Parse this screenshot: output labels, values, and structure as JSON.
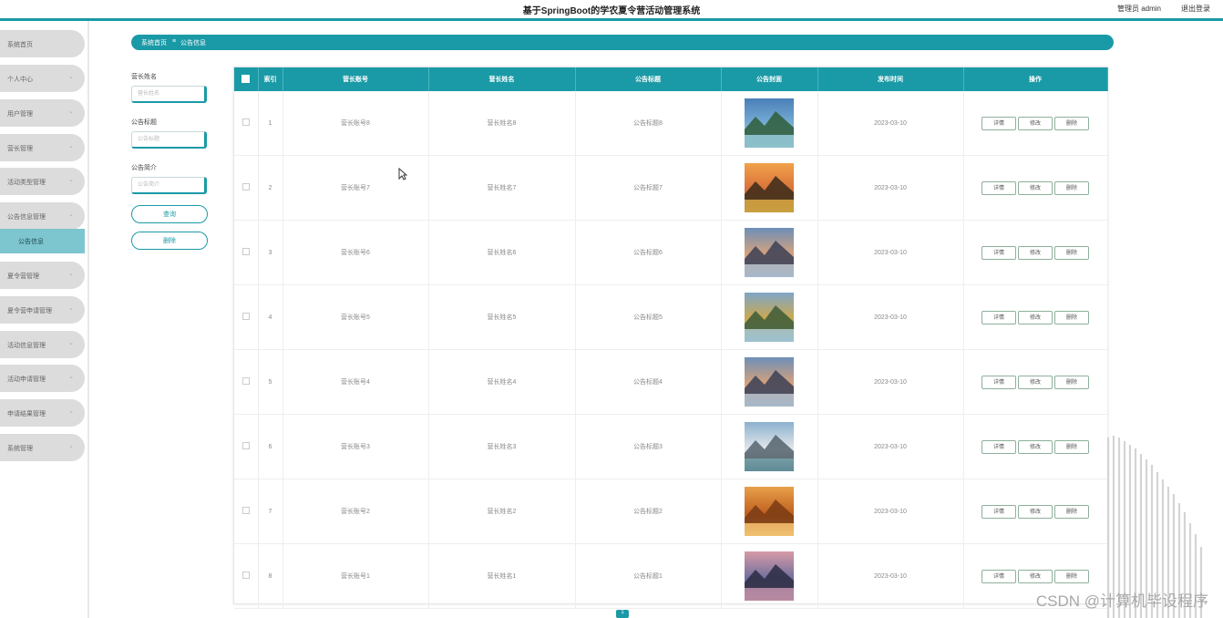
{
  "app": {
    "title": "基于SpringBoot的学农夏令营活动管理系统",
    "user": "管理员 admin",
    "logout": "退出登录"
  },
  "sidebar": {
    "items": [
      {
        "label": "系统首页",
        "arrow": false
      },
      {
        "label": "个人中心",
        "arrow": true
      },
      {
        "label": "用户管理",
        "arrow": true
      },
      {
        "label": "营长管理",
        "arrow": true
      },
      {
        "label": "活动类型管理",
        "arrow": true
      },
      {
        "label": "公告信息管理",
        "arrow": true
      },
      {
        "label": "夏令营管理",
        "arrow": true
      },
      {
        "label": "夏令营申请管理",
        "arrow": true
      },
      {
        "label": "活动信息管理",
        "arrow": true
      },
      {
        "label": "活动申请管理",
        "arrow": true
      },
      {
        "label": "申请结果管理",
        "arrow": true
      },
      {
        "label": "系统管理",
        "arrow": true
      }
    ],
    "submenu": "公告信息"
  },
  "breadcrumb": {
    "home": "系统首页",
    "sep": "≡",
    "current": "公告信息"
  },
  "search": {
    "fields": [
      {
        "label": "营长姓名",
        "placeholder": "营长姓名"
      },
      {
        "label": "公告标题",
        "placeholder": "公告标题"
      },
      {
        "label": "公告简介",
        "placeholder": "公告简介"
      }
    ],
    "query_button": "查询",
    "delete_button": "删除"
  },
  "table": {
    "headers": [
      "索引",
      "营长账号",
      "营长姓名",
      "公告标题",
      "公告封面",
      "发布时间",
      "操作"
    ],
    "rows": [
      {
        "index": "1",
        "account": "营长账号8",
        "name": "营长姓名8",
        "title": "公告标题8",
        "date": "2023-03-10"
      },
      {
        "index": "2",
        "account": "营长账号7",
        "name": "营长姓名7",
        "title": "公告标题7",
        "date": "2023-03-10"
      },
      {
        "index": "3",
        "account": "营长账号6",
        "name": "营长姓名6",
        "title": "公告标题6",
        "date": "2023-03-10"
      },
      {
        "index": "4",
        "account": "营长账号5",
        "name": "营长姓名5",
        "title": "公告标题5",
        "date": "2023-03-10"
      },
      {
        "index": "5",
        "account": "营长账号4",
        "name": "营长姓名4",
        "title": "公告标题4",
        "date": "2023-03-10"
      },
      {
        "index": "6",
        "account": "营长账号3",
        "name": "营长姓名3",
        "title": "公告标题3",
        "date": "2023-03-10"
      },
      {
        "index": "7",
        "account": "营长账号2",
        "name": "营长姓名2",
        "title": "公告标题2",
        "date": "2023-03-10"
      },
      {
        "index": "8",
        "account": "营长账号1",
        "name": "营长姓名1",
        "title": "公告标题1",
        "date": "2023-03-10"
      }
    ],
    "actions": {
      "detail": "详情",
      "edit": "修改",
      "delete": "删除"
    }
  },
  "pagination": {
    "current_page": "1"
  },
  "watermark": "CSDN @计算机毕设程序",
  "colors": {
    "accent": "#1a9aa6",
    "submenu": "#7ec6cf",
    "menu": "#dcdcdc"
  }
}
